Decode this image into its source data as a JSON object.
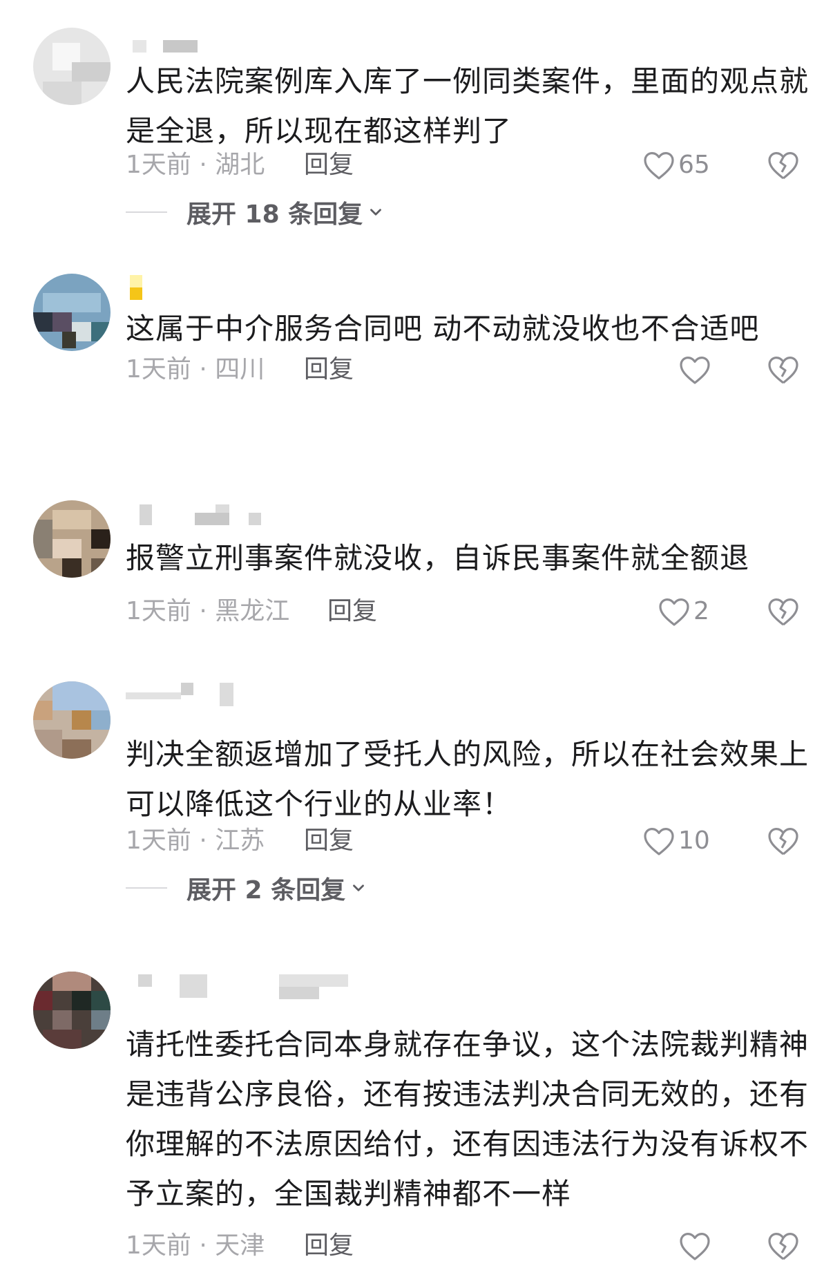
{
  "comments": [
    {
      "text": "人民法院案例库入库了一例同类案件，里面的观点就是全退，所以现在都这样判了",
      "meta": "1天前 · 湖北",
      "reply_label": "回复",
      "like_count": "65",
      "expand_label": "展开 18 条回复",
      "avatar_icon": "avatar-icon",
      "like_icon": "heart-outline-icon",
      "dislike_icon": "broken-heart-icon",
      "expand_icon": "chevron-down-icon"
    },
    {
      "text": "这属于中介服务合同吧 动不动就没收也不合适吧",
      "meta": "1天前 · 四川",
      "reply_label": "回复",
      "like_count": "",
      "avatar_icon": "avatar-icon",
      "like_icon": "heart-outline-icon",
      "dislike_icon": "broken-heart-icon"
    },
    {
      "text": "报警立刑事案件就没收，自诉民事案件就全额退",
      "meta": "1天前 · 黑龙江",
      "reply_label": "回复",
      "like_count": "2",
      "avatar_icon": "avatar-icon",
      "like_icon": "heart-outline-icon",
      "dislike_icon": "broken-heart-icon"
    },
    {
      "text": "判决全额返增加了受托人的风险，所以在社会效果上可以降低这个行业的从业率！",
      "meta": "1天前 · 江苏",
      "reply_label": "回复",
      "like_count": "10",
      "expand_label": "展开 2 条回复",
      "avatar_icon": "avatar-icon",
      "like_icon": "heart-outline-icon",
      "dislike_icon": "broken-heart-icon",
      "expand_icon": "chevron-down-icon"
    },
    {
      "text": "请托性委托合同本身就存在争议，这个法院裁判精神是违背公序良俗，还有按违法判决合同无效的，还有你理解的不法原因给付，还有因违法行为没有诉权不予立案的，全国裁判精神都不一样",
      "meta": "1天前 · 天津",
      "reply_label": "回复",
      "like_count": "",
      "avatar_icon": "avatar-icon",
      "like_icon": "heart-outline-icon",
      "dislike_icon": "broken-heart-icon"
    }
  ],
  "colors": {
    "text": "#1c1c1e",
    "meta": "#a7a7ab",
    "reply": "#5d5d62",
    "icon": "#8e8e93"
  }
}
